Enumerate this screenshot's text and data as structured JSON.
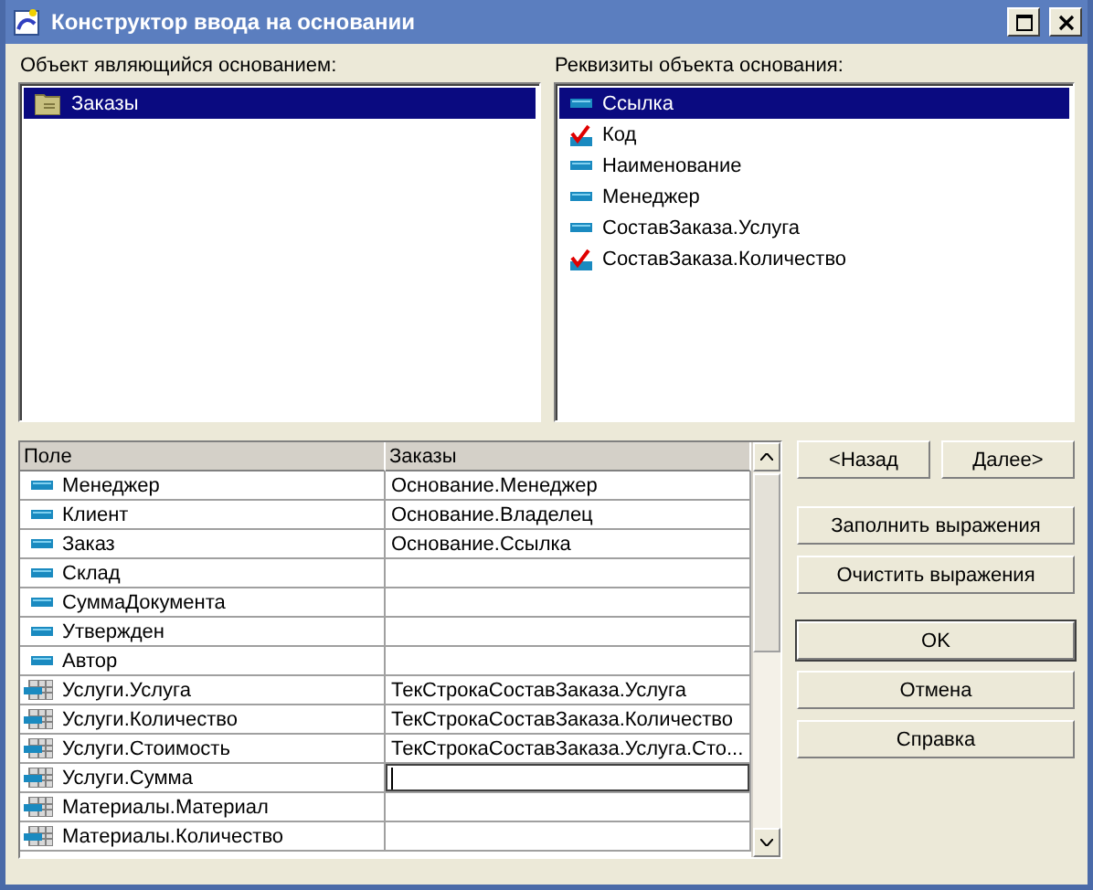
{
  "window": {
    "title": "Конструктор ввода на основании"
  },
  "base_objects": {
    "label": "Объект являющийся основанием:",
    "items": [
      {
        "text": "Заказы",
        "selected": true
      }
    ]
  },
  "attributes": {
    "label": "Реквизиты объекта основания:",
    "items": [
      {
        "text": "Ссылка",
        "selected": true,
        "checked": false
      },
      {
        "text": "Код",
        "selected": false,
        "checked": true
      },
      {
        "text": "Наименование",
        "selected": false,
        "checked": false
      },
      {
        "text": "Менеджер",
        "selected": false,
        "checked": false
      },
      {
        "text": "СоставЗаказа.Услуга",
        "selected": false,
        "checked": false
      },
      {
        "text": "СоставЗаказа.Количество",
        "selected": false,
        "checked": true
      }
    ]
  },
  "table": {
    "columns": [
      "Поле",
      "Заказы"
    ],
    "rows": [
      {
        "kind": "field",
        "field": "Менеджер",
        "value": "Основание.Менеджер",
        "editing": false
      },
      {
        "kind": "field",
        "field": "Клиент",
        "value": "Основание.Владелец",
        "editing": false
      },
      {
        "kind": "field",
        "field": "Заказ",
        "value": "Основание.Ссылка",
        "editing": false
      },
      {
        "kind": "field",
        "field": "Склад",
        "value": "",
        "editing": false
      },
      {
        "kind": "field",
        "field": "СуммаДокумента",
        "value": "",
        "editing": false
      },
      {
        "kind": "field",
        "field": "Утвержден",
        "value": "",
        "editing": false
      },
      {
        "kind": "field",
        "field": "Автор",
        "value": "",
        "editing": false
      },
      {
        "kind": "tabular",
        "field": "Услуги.Услуга",
        "value": "ТекСтрокаСоставЗаказа.Услуга",
        "editing": false
      },
      {
        "kind": "tabular",
        "field": "Услуги.Количество",
        "value": "ТекСтрокаСоставЗаказа.Количество",
        "editing": false
      },
      {
        "kind": "tabular",
        "field": "Услуги.Стоимость",
        "value": "ТекСтрокаСоставЗаказа.Услуга.Сто...",
        "editing": false
      },
      {
        "kind": "tabular",
        "field": "Услуги.Сумма",
        "value": "",
        "editing": true
      },
      {
        "kind": "tabular",
        "field": "Материалы.Материал",
        "value": "",
        "editing": false
      },
      {
        "kind": "tabular",
        "field": "Материалы.Количество",
        "value": "",
        "editing": false
      }
    ]
  },
  "nav_buttons": [
    "<Назад",
    "Далее>"
  ],
  "expression_buttons": [
    "Заполнить выражения",
    "Очистить выражения"
  ],
  "dialog_buttons": [
    {
      "text": "OK",
      "default": true
    },
    {
      "text": "Отмена",
      "default": false
    },
    {
      "text": "Справка",
      "default": false
    }
  ]
}
